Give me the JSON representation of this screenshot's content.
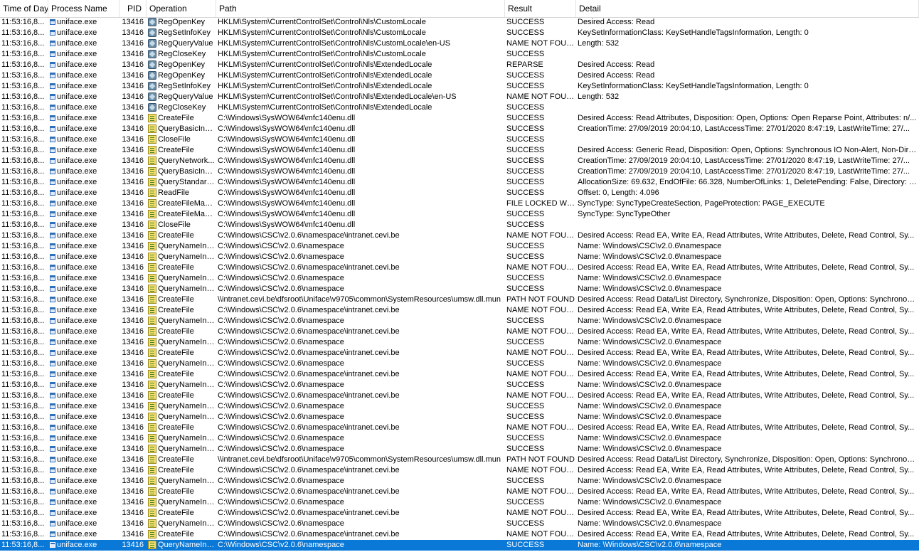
{
  "columns": {
    "time": "Time of Day",
    "process": "Process Name",
    "pid": "PID",
    "operation": "Operation",
    "path": "Path",
    "result": "Result",
    "detail": "Detail"
  },
  "icons": {
    "process": "application-window-icon",
    "registry": "registry-cube-icon",
    "file": "file-system-icon"
  },
  "colors": {
    "selection": "#0a78d7",
    "header_border": "#d6d6d6"
  },
  "rows": [
    {
      "time": "11:53:16,8...",
      "process": "uniface.exe",
      "pid": "13416",
      "operation": "RegOpenKey",
      "type": "registry",
      "path": "HKLM\\System\\CurrentControlSet\\Control\\Nls\\CustomLocale",
      "result": "SUCCESS",
      "detail": "Desired Access: Read"
    },
    {
      "time": "11:53:16,8...",
      "process": "uniface.exe",
      "pid": "13416",
      "operation": "RegSetInfoKey",
      "type": "registry",
      "path": "HKLM\\System\\CurrentControlSet\\Control\\Nls\\CustomLocale",
      "result": "SUCCESS",
      "detail": "KeySetInformationClass: KeySetHandleTagsInformation, Length: 0"
    },
    {
      "time": "11:53:16,8...",
      "process": "uniface.exe",
      "pid": "13416",
      "operation": "RegQueryValue",
      "type": "registry",
      "path": "HKLM\\System\\CurrentControlSet\\Control\\Nls\\CustomLocale\\en-US",
      "result": "NAME NOT FOUND",
      "detail": "Length: 532"
    },
    {
      "time": "11:53:16,8...",
      "process": "uniface.exe",
      "pid": "13416",
      "operation": "RegCloseKey",
      "type": "registry",
      "path": "HKLM\\System\\CurrentControlSet\\Control\\Nls\\CustomLocale",
      "result": "SUCCESS",
      "detail": ""
    },
    {
      "time": "11:53:16,8...",
      "process": "uniface.exe",
      "pid": "13416",
      "operation": "RegOpenKey",
      "type": "registry",
      "path": "HKLM\\System\\CurrentControlSet\\Control\\Nls\\ExtendedLocale",
      "result": "REPARSE",
      "detail": "Desired Access: Read"
    },
    {
      "time": "11:53:16,8...",
      "process": "uniface.exe",
      "pid": "13416",
      "operation": "RegOpenKey",
      "type": "registry",
      "path": "HKLM\\System\\CurrentControlSet\\Control\\Nls\\ExtendedLocale",
      "result": "SUCCESS",
      "detail": "Desired Access: Read"
    },
    {
      "time": "11:53:16,8...",
      "process": "uniface.exe",
      "pid": "13416",
      "operation": "RegSetInfoKey",
      "type": "registry",
      "path": "HKLM\\System\\CurrentControlSet\\Control\\Nls\\ExtendedLocale",
      "result": "SUCCESS",
      "detail": "KeySetInformationClass: KeySetHandleTagsInformation, Length: 0"
    },
    {
      "time": "11:53:16,8...",
      "process": "uniface.exe",
      "pid": "13416",
      "operation": "RegQueryValue",
      "type": "registry",
      "path": "HKLM\\System\\CurrentControlSet\\Control\\Nls\\ExtendedLocale\\en-US",
      "result": "NAME NOT FOUND",
      "detail": "Length: 532"
    },
    {
      "time": "11:53:16,8...",
      "process": "uniface.exe",
      "pid": "13416",
      "operation": "RegCloseKey",
      "type": "registry",
      "path": "HKLM\\System\\CurrentControlSet\\Control\\Nls\\ExtendedLocale",
      "result": "SUCCESS",
      "detail": ""
    },
    {
      "time": "11:53:16,8...",
      "process": "uniface.exe",
      "pid": "13416",
      "operation": "CreateFile",
      "type": "file",
      "path": "C:\\Windows\\SysWOW64\\mfc140enu.dll",
      "result": "SUCCESS",
      "detail": "Desired Access: Read Attributes, Disposition: Open, Options: Open Reparse Point, Attributes: n/..."
    },
    {
      "time": "11:53:16,8...",
      "process": "uniface.exe",
      "pid": "13416",
      "operation": "QueryBasicInfor...",
      "type": "file",
      "path": "C:\\Windows\\SysWOW64\\mfc140enu.dll",
      "result": "SUCCESS",
      "detail": "CreationTime: 27/09/2019 20:04:10, LastAccessTime: 27/01/2020 8:47:19, LastWriteTime: 27/..."
    },
    {
      "time": "11:53:16,8...",
      "process": "uniface.exe",
      "pid": "13416",
      "operation": "CloseFile",
      "type": "file",
      "path": "C:\\Windows\\SysWOW64\\mfc140enu.dll",
      "result": "SUCCESS",
      "detail": ""
    },
    {
      "time": "11:53:16,8...",
      "process": "uniface.exe",
      "pid": "13416",
      "operation": "CreateFile",
      "type": "file",
      "path": "C:\\Windows\\SysWOW64\\mfc140enu.dll",
      "result": "SUCCESS",
      "detail": "Desired Access: Generic Read, Disposition: Open, Options: Synchronous IO Non-Alert, Non-Dire..."
    },
    {
      "time": "11:53:16,8...",
      "process": "uniface.exe",
      "pid": "13416",
      "operation": "QueryNetwork...",
      "type": "file",
      "path": "C:\\Windows\\SysWOW64\\mfc140enu.dll",
      "result": "SUCCESS",
      "detail": "CreationTime: 27/09/2019 20:04:10, LastAccessTime: 27/01/2020 8:47:19, LastWriteTime: 27/..."
    },
    {
      "time": "11:53:16,8...",
      "process": "uniface.exe",
      "pid": "13416",
      "operation": "QueryBasicInfor...",
      "type": "file",
      "path": "C:\\Windows\\SysWOW64\\mfc140enu.dll",
      "result": "SUCCESS",
      "detail": "CreationTime: 27/09/2019 20:04:10, LastAccessTime: 27/01/2020 8:47:19, LastWriteTime: 27/..."
    },
    {
      "time": "11:53:16,8...",
      "process": "uniface.exe",
      "pid": "13416",
      "operation": "QueryStandardI...",
      "type": "file",
      "path": "C:\\Windows\\SysWOW64\\mfc140enu.dll",
      "result": "SUCCESS",
      "detail": "AllocationSize: 69.632, EndOfFile: 66.328, NumberOfLinks: 1, DeletePending: False, Directory: F..."
    },
    {
      "time": "11:53:16,8...",
      "process": "uniface.exe",
      "pid": "13416",
      "operation": "ReadFile",
      "type": "file",
      "path": "C:\\Windows\\SysWOW64\\mfc140enu.dll",
      "result": "SUCCESS",
      "detail": "Offset: 0, Length: 4.096"
    },
    {
      "time": "11:53:16,8...",
      "process": "uniface.exe",
      "pid": "13416",
      "operation": "CreateFileMapp...",
      "type": "file",
      "path": "C:\\Windows\\SysWOW64\\mfc140enu.dll",
      "result": "FILE LOCKED WI...",
      "detail": "SyncType: SyncTypeCreateSection, PageProtection: PAGE_EXECUTE"
    },
    {
      "time": "11:53:16,8...",
      "process": "uniface.exe",
      "pid": "13416",
      "operation": "CreateFileMapp...",
      "type": "file",
      "path": "C:\\Windows\\SysWOW64\\mfc140enu.dll",
      "result": "SUCCESS",
      "detail": "SyncType: SyncTypeOther"
    },
    {
      "time": "11:53:16,8...",
      "process": "uniface.exe",
      "pid": "13416",
      "operation": "CloseFile",
      "type": "file",
      "path": "C:\\Windows\\SysWOW64\\mfc140enu.dll",
      "result": "SUCCESS",
      "detail": ""
    },
    {
      "time": "11:53:16,8...",
      "process": "uniface.exe",
      "pid": "13416",
      "operation": "CreateFile",
      "type": "file",
      "path": "C:\\Windows\\CSC\\v2.0.6\\namespace\\intranet.cevi.be",
      "result": "NAME NOT FOUND",
      "detail": "Desired Access: Read EA, Write EA, Read Attributes, Write Attributes, Delete, Read Control, Sy..."
    },
    {
      "time": "11:53:16,8...",
      "process": "uniface.exe",
      "pid": "13416",
      "operation": "QueryNameInfo...",
      "type": "file",
      "path": "C:\\Windows\\CSC\\v2.0.6\\namespace",
      "result": "SUCCESS",
      "detail": "Name: \\Windows\\CSC\\v2.0.6\\namespace"
    },
    {
      "time": "11:53:16,8...",
      "process": "uniface.exe",
      "pid": "13416",
      "operation": "QueryNameInfo...",
      "type": "file",
      "path": "C:\\Windows\\CSC\\v2.0.6\\namespace",
      "result": "SUCCESS",
      "detail": "Name: \\Windows\\CSC\\v2.0.6\\namespace"
    },
    {
      "time": "11:53:16,8...",
      "process": "uniface.exe",
      "pid": "13416",
      "operation": "CreateFile",
      "type": "file",
      "path": "C:\\Windows\\CSC\\v2.0.6\\namespace\\intranet.cevi.be",
      "result": "NAME NOT FOUND",
      "detail": "Desired Access: Read EA, Write EA, Read Attributes, Write Attributes, Delete, Read Control, Sy..."
    },
    {
      "time": "11:53:16,8...",
      "process": "uniface.exe",
      "pid": "13416",
      "operation": "QueryNameInfo...",
      "type": "file",
      "path": "C:\\Windows\\CSC\\v2.0.6\\namespace",
      "result": "SUCCESS",
      "detail": "Name: \\Windows\\CSC\\v2.0.6\\namespace"
    },
    {
      "time": "11:53:16,8...",
      "process": "uniface.exe",
      "pid": "13416",
      "operation": "QueryNameInfo...",
      "type": "file",
      "path": "C:\\Windows\\CSC\\v2.0.6\\namespace",
      "result": "SUCCESS",
      "detail": "Name: \\Windows\\CSC\\v2.0.6\\namespace"
    },
    {
      "time": "11:53:16,8...",
      "process": "uniface.exe",
      "pid": "13416",
      "operation": "CreateFile",
      "type": "file",
      "path": "\\\\intranet.cevi.be\\dfsroot\\Uniface\\v9705\\common\\SystemResources\\umsw.dll.mun",
      "result": "PATH NOT FOUND",
      "detail": "Desired Access: Read Data/List Directory, Synchronize, Disposition: Open, Options: Synchronou..."
    },
    {
      "time": "11:53:16,8...",
      "process": "uniface.exe",
      "pid": "13416",
      "operation": "CreateFile",
      "type": "file",
      "path": "C:\\Windows\\CSC\\v2.0.6\\namespace\\intranet.cevi.be",
      "result": "NAME NOT FOUND",
      "detail": "Desired Access: Read EA, Write EA, Read Attributes, Write Attributes, Delete, Read Control, Sy..."
    },
    {
      "time": "11:53:16,8...",
      "process": "uniface.exe",
      "pid": "13416",
      "operation": "QueryNameInfo...",
      "type": "file",
      "path": "C:\\Windows\\CSC\\v2.0.6\\namespace",
      "result": "SUCCESS",
      "detail": "Name: \\Windows\\CSC\\v2.0.6\\namespace"
    },
    {
      "time": "11:53:16,8...",
      "process": "uniface.exe",
      "pid": "13416",
      "operation": "CreateFile",
      "type": "file",
      "path": "C:\\Windows\\CSC\\v2.0.6\\namespace\\intranet.cevi.be",
      "result": "NAME NOT FOUND",
      "detail": "Desired Access: Read EA, Write EA, Read Attributes, Write Attributes, Delete, Read Control, Sy..."
    },
    {
      "time": "11:53:16,8...",
      "process": "uniface.exe",
      "pid": "13416",
      "operation": "QueryNameInfo...",
      "type": "file",
      "path": "C:\\Windows\\CSC\\v2.0.6\\namespace",
      "result": "SUCCESS",
      "detail": "Name: \\Windows\\CSC\\v2.0.6\\namespace"
    },
    {
      "time": "11:53:16,8...",
      "process": "uniface.exe",
      "pid": "13416",
      "operation": "CreateFile",
      "type": "file",
      "path": "C:\\Windows\\CSC\\v2.0.6\\namespace\\intranet.cevi.be",
      "result": "NAME NOT FOUND",
      "detail": "Desired Access: Read EA, Write EA, Read Attributes, Write Attributes, Delete, Read Control, Sy..."
    },
    {
      "time": "11:53:16,8...",
      "process": "uniface.exe",
      "pid": "13416",
      "operation": "QueryNameInfo...",
      "type": "file",
      "path": "C:\\Windows\\CSC\\v2.0.6\\namespace",
      "result": "SUCCESS",
      "detail": "Name: \\Windows\\CSC\\v2.0.6\\namespace"
    },
    {
      "time": "11:53:16,8...",
      "process": "uniface.exe",
      "pid": "13416",
      "operation": "CreateFile",
      "type": "file",
      "path": "C:\\Windows\\CSC\\v2.0.6\\namespace\\intranet.cevi.be",
      "result": "NAME NOT FOUND",
      "detail": "Desired Access: Read EA, Write EA, Read Attributes, Write Attributes, Delete, Read Control, Sy..."
    },
    {
      "time": "11:53:16,8...",
      "process": "uniface.exe",
      "pid": "13416",
      "operation": "QueryNameInfo...",
      "type": "file",
      "path": "C:\\Windows\\CSC\\v2.0.6\\namespace",
      "result": "SUCCESS",
      "detail": "Name: \\Windows\\CSC\\v2.0.6\\namespace"
    },
    {
      "time": "11:53:16,8...",
      "process": "uniface.exe",
      "pid": "13416",
      "operation": "CreateFile",
      "type": "file",
      "path": "C:\\Windows\\CSC\\v2.0.6\\namespace\\intranet.cevi.be",
      "result": "NAME NOT FOUND",
      "detail": "Desired Access: Read EA, Write EA, Read Attributes, Write Attributes, Delete, Read Control, Sy..."
    },
    {
      "time": "11:53:16,8...",
      "process": "uniface.exe",
      "pid": "13416",
      "operation": "QueryNameInfo...",
      "type": "file",
      "path": "C:\\Windows\\CSC\\v2.0.6\\namespace",
      "result": "SUCCESS",
      "detail": "Name: \\Windows\\CSC\\v2.0.6\\namespace"
    },
    {
      "time": "11:53:16,8...",
      "process": "uniface.exe",
      "pid": "13416",
      "operation": "QueryNameInfo...",
      "type": "file",
      "path": "C:\\Windows\\CSC\\v2.0.6\\namespace",
      "result": "SUCCESS",
      "detail": "Name: \\Windows\\CSC\\v2.0.6\\namespace"
    },
    {
      "time": "11:53:16,8...",
      "process": "uniface.exe",
      "pid": "13416",
      "operation": "CreateFile",
      "type": "file",
      "path": "C:\\Windows\\CSC\\v2.0.6\\namespace\\intranet.cevi.be",
      "result": "NAME NOT FOUND",
      "detail": "Desired Access: Read EA, Write EA, Read Attributes, Write Attributes, Delete, Read Control, Sy..."
    },
    {
      "time": "11:53:16,8...",
      "process": "uniface.exe",
      "pid": "13416",
      "operation": "QueryNameInfo...",
      "type": "file",
      "path": "C:\\Windows\\CSC\\v2.0.6\\namespace",
      "result": "SUCCESS",
      "detail": "Name: \\Windows\\CSC\\v2.0.6\\namespace"
    },
    {
      "time": "11:53:16,8...",
      "process": "uniface.exe",
      "pid": "13416",
      "operation": "QueryNameInfo...",
      "type": "file",
      "path": "C:\\Windows\\CSC\\v2.0.6\\namespace",
      "result": "SUCCESS",
      "detail": "Name: \\Windows\\CSC\\v2.0.6\\namespace"
    },
    {
      "time": "11:53:16,8...",
      "process": "uniface.exe",
      "pid": "13416",
      "operation": "CreateFile",
      "type": "file",
      "path": "\\\\intranet.cevi.be\\dfsroot\\Uniface\\v9705\\common\\SystemResources\\umsw.dll.mun",
      "result": "PATH NOT FOUND",
      "detail": "Desired Access: Read Data/List Directory, Synchronize, Disposition: Open, Options: Synchronou..."
    },
    {
      "time": "11:53:16,8...",
      "process": "uniface.exe",
      "pid": "13416",
      "operation": "CreateFile",
      "type": "file",
      "path": "C:\\Windows\\CSC\\v2.0.6\\namespace\\intranet.cevi.be",
      "result": "NAME NOT FOUND",
      "detail": "Desired Access: Read EA, Write EA, Read Attributes, Write Attributes, Delete, Read Control, Sy..."
    },
    {
      "time": "11:53:16,8...",
      "process": "uniface.exe",
      "pid": "13416",
      "operation": "QueryNameInfo...",
      "type": "file",
      "path": "C:\\Windows\\CSC\\v2.0.6\\namespace",
      "result": "SUCCESS",
      "detail": "Name: \\Windows\\CSC\\v2.0.6\\namespace"
    },
    {
      "time": "11:53:16,8...",
      "process": "uniface.exe",
      "pid": "13416",
      "operation": "CreateFile",
      "type": "file",
      "path": "C:\\Windows\\CSC\\v2.0.6\\namespace\\intranet.cevi.be",
      "result": "NAME NOT FOUND",
      "detail": "Desired Access: Read EA, Write EA, Read Attributes, Write Attributes, Delete, Read Control, Sy..."
    },
    {
      "time": "11:53:16,8...",
      "process": "uniface.exe",
      "pid": "13416",
      "operation": "QueryNameInfo...",
      "type": "file",
      "path": "C:\\Windows\\CSC\\v2.0.6\\namespace",
      "result": "SUCCESS",
      "detail": "Name: \\Windows\\CSC\\v2.0.6\\namespace"
    },
    {
      "time": "11:53:16,8...",
      "process": "uniface.exe",
      "pid": "13416",
      "operation": "CreateFile",
      "type": "file",
      "path": "C:\\Windows\\CSC\\v2.0.6\\namespace\\intranet.cevi.be",
      "result": "NAME NOT FOUND",
      "detail": "Desired Access: Read EA, Write EA, Read Attributes, Write Attributes, Delete, Read Control, Sy..."
    },
    {
      "time": "11:53:16,8...",
      "process": "uniface.exe",
      "pid": "13416",
      "operation": "QueryNameInfo...",
      "type": "file",
      "path": "C:\\Windows\\CSC\\v2.0.6\\namespace",
      "result": "SUCCESS",
      "detail": "Name: \\Windows\\CSC\\v2.0.6\\namespace"
    },
    {
      "time": "11:53:16,8...",
      "process": "uniface.exe",
      "pid": "13416",
      "operation": "CreateFile",
      "type": "file",
      "path": "C:\\Windows\\CSC\\v2.0.6\\namespace\\intranet.cevi.be",
      "result": "NAME NOT FOUND",
      "detail": "Desired Access: Read EA, Write EA, Read Attributes, Write Attributes, Delete, Read Control, Sy..."
    },
    {
      "time": "11:53:16,8...",
      "process": "uniface.exe",
      "pid": "13416",
      "operation": "QueryNameInfo...",
      "type": "file",
      "path": "C:\\Windows\\CSC\\v2.0.6\\namespace",
      "result": "SUCCESS",
      "detail": "Name: \\Windows\\CSC\\v2.0.6\\namespace",
      "selected": true
    }
  ]
}
